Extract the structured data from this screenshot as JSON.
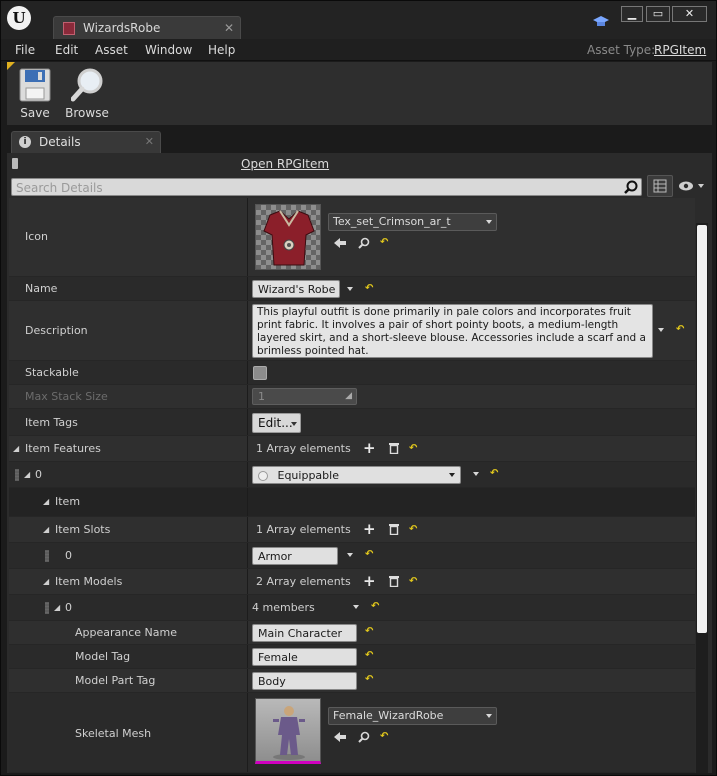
{
  "window": {
    "tab_title": "WizardsRobe",
    "min_glyph": "▁",
    "max_glyph": "▭",
    "close_glyph": "✕"
  },
  "menu": [
    "File",
    "Edit",
    "Asset",
    "Window",
    "Help"
  ],
  "asset_type": {
    "label": "Asset Type:",
    "value": "RPGItem"
  },
  "toolbar": {
    "save_label": "Save",
    "browse_label": "Browse"
  },
  "details": {
    "tab_label": "Details",
    "open_link": "Open RPGItem",
    "search_placeholder": "Search Details"
  },
  "properties": {
    "icon": {
      "label": "Icon",
      "asset": "Tex_set_Crimson_ar_t"
    },
    "name": {
      "label": "Name",
      "value": "Wizard's Robe"
    },
    "description": {
      "label": "Description",
      "value": "This playful outfit is done primarily in pale colors and incorporates fruit print fabric.  It involves a pair of short pointy boots, a medium-length layered skirt, and a short-sleeve blouse.  Accessories include a scarf and a brimless pointed hat."
    },
    "stackable": {
      "label": "Stackable",
      "checked": false
    },
    "max_stack": {
      "label": "Max Stack Size",
      "value": "1"
    },
    "item_tags": {
      "label": "Item Tags",
      "button": "Edit..."
    },
    "item_features": {
      "label": "Item Features",
      "count": "1 Array elements"
    },
    "feature_0": {
      "index": "0",
      "value": "Equippable"
    },
    "item_category": {
      "label": "Item"
    },
    "item_slots": {
      "label": "Item Slots",
      "count": "1 Array elements"
    },
    "slot_0": {
      "index": "0",
      "value": "Armor"
    },
    "item_models": {
      "label": "Item Models",
      "count": "2 Array elements"
    },
    "model_0": {
      "index": "0",
      "members": "4 members"
    },
    "appearance_name": {
      "label": "Appearance Name",
      "value": "Main Character"
    },
    "model_tag": {
      "label": "Model Tag",
      "value": "Female"
    },
    "model_part_tag": {
      "label": "Model Part Tag",
      "value": "Body"
    },
    "skeletal_mesh": {
      "label": "Skeletal Mesh",
      "asset": "Female_WizardRobe"
    }
  },
  "colors": {
    "accent_reset": "#e2c81c",
    "tab_icon": "#8a2a3a"
  }
}
